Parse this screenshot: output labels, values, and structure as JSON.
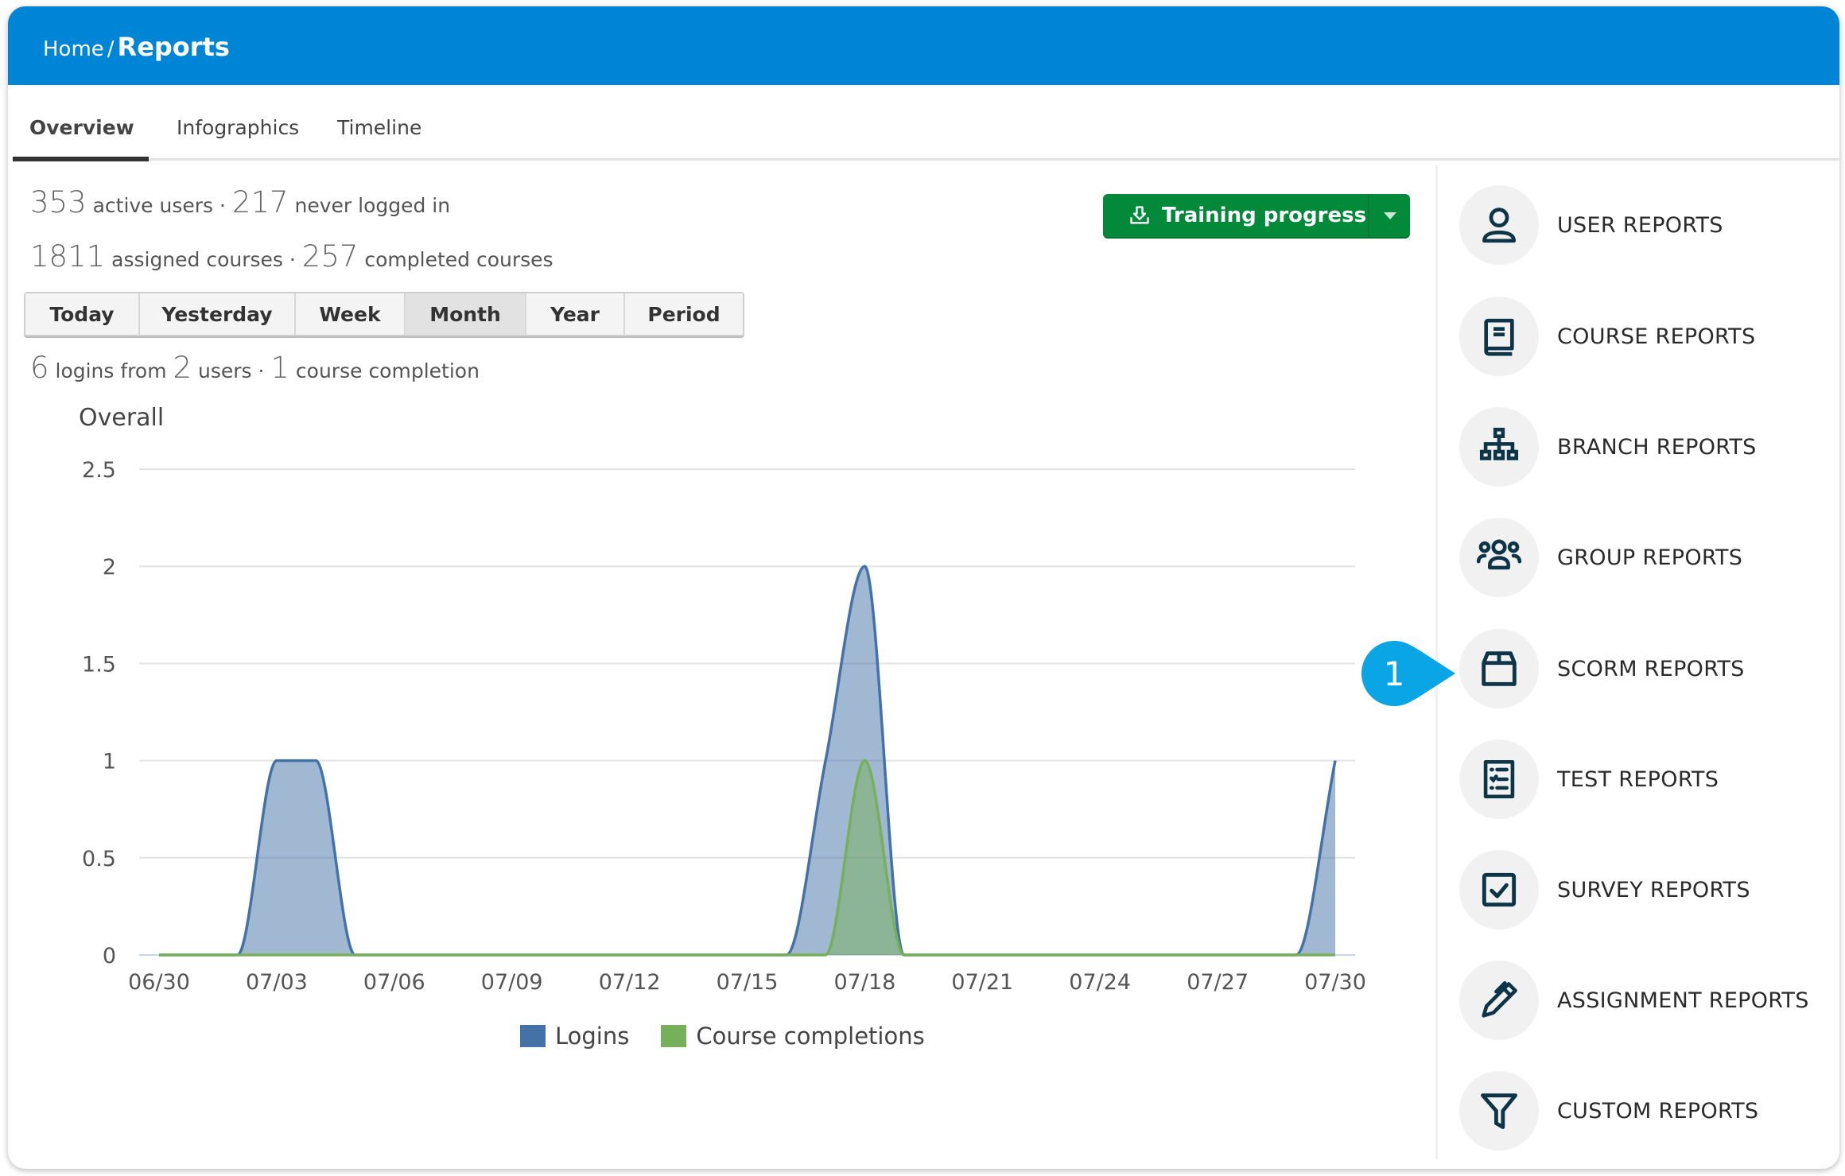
{
  "header": {
    "breadcrumb_home": "Home",
    "breadcrumb_sep": "/",
    "breadcrumb_current": "Reports",
    "color": "#0084d6"
  },
  "tabs": [
    {
      "label": "Overview",
      "active": true
    },
    {
      "label": "Infographics",
      "active": false
    },
    {
      "label": "Timeline",
      "active": false
    }
  ],
  "stats": {
    "active_users": "353",
    "active_users_label": "active users ·",
    "never_logged_in": "217",
    "never_logged_in_label": "never logged in",
    "assigned_courses": "1811",
    "assigned_courses_label": "assigned courses ·",
    "completed_courses": "257",
    "completed_courses_label": "completed courses",
    "logins": "6",
    "logins_label": "logins from",
    "users": "2",
    "users_label": "users ·",
    "course_completions": "1",
    "course_completions_label": "course completion"
  },
  "period_buttons": [
    {
      "label": "Today",
      "active": false
    },
    {
      "label": "Yesterday",
      "active": false
    },
    {
      "label": "Week",
      "active": false
    },
    {
      "label": "Month",
      "active": true
    },
    {
      "label": "Year",
      "active": false
    },
    {
      "label": "Period",
      "active": false
    }
  ],
  "training_button": {
    "label": "Training progress",
    "icon": "download-icon",
    "color": "#02893a"
  },
  "sidebar": {
    "items": [
      {
        "label": "USER REPORTS",
        "icon": "user-icon"
      },
      {
        "label": "COURSE REPORTS",
        "icon": "book-icon"
      },
      {
        "label": "BRANCH REPORTS",
        "icon": "sitemap-icon"
      },
      {
        "label": "GROUP REPORTS",
        "icon": "group-icon"
      },
      {
        "label": "SCORM REPORTS",
        "icon": "box-icon"
      },
      {
        "label": "TEST REPORTS",
        "icon": "checklist-icon"
      },
      {
        "label": "SURVEY REPORTS",
        "icon": "checkbox-icon"
      },
      {
        "label": "ASSIGNMENT REPORTS",
        "icon": "pen-icon"
      },
      {
        "label": "CUSTOM REPORTS",
        "icon": "filter-icon"
      }
    ]
  },
  "callout": {
    "number": "1",
    "color": "#0aa5e4"
  },
  "chart_data": {
    "type": "area",
    "title": "Overall",
    "xlabel": "",
    "ylabel": "",
    "ylim": [
      0,
      2.5
    ],
    "yticks": [
      0,
      0.5,
      1,
      1.5,
      2,
      2.5
    ],
    "ytick_labels": [
      "0",
      "0.5",
      "1",
      "1.5",
      "2",
      "2.5"
    ],
    "x": [
      "06/30",
      "07/01",
      "07/02",
      "07/03",
      "07/04",
      "07/05",
      "07/06",
      "07/07",
      "07/08",
      "07/09",
      "07/10",
      "07/11",
      "07/12",
      "07/13",
      "07/14",
      "07/15",
      "07/16",
      "07/17",
      "07/18",
      "07/19",
      "07/20",
      "07/21",
      "07/22",
      "07/23",
      "07/24",
      "07/25",
      "07/26",
      "07/27",
      "07/28",
      "07/29",
      "07/30"
    ],
    "xtick_labels": [
      "06/30",
      "07/03",
      "07/06",
      "07/09",
      "07/12",
      "07/15",
      "07/18",
      "07/21",
      "07/24",
      "07/27",
      "07/30"
    ],
    "grid": true,
    "legend_position": "bottom",
    "series": [
      {
        "name": "Logins",
        "color": "#4472a8",
        "values": [
          0,
          0,
          0,
          1,
          1,
          0,
          0,
          0,
          0,
          0,
          0,
          0,
          0,
          0,
          0,
          0,
          0,
          1,
          2,
          0,
          0,
          0,
          0,
          0,
          0,
          0,
          0,
          0,
          0,
          0,
          1
        ]
      },
      {
        "name": "Course completions",
        "color": "#77b05a",
        "values": [
          0,
          0,
          0,
          0,
          0,
          0,
          0,
          0,
          0,
          0,
          0,
          0,
          0,
          0,
          0,
          0,
          0,
          0,
          1,
          0,
          0,
          0,
          0,
          0,
          0,
          0,
          0,
          0,
          0,
          0,
          0
        ]
      }
    ]
  }
}
